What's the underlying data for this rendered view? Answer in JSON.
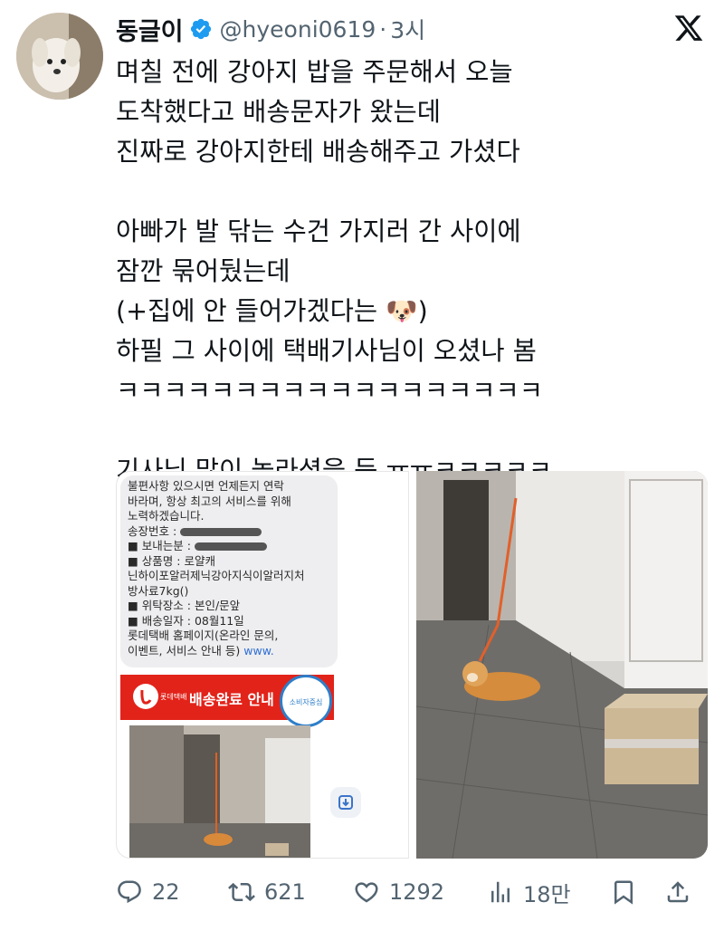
{
  "author": {
    "display_name": "동글이",
    "handle": "@hyeoni0619",
    "separator": "·",
    "time": "3시"
  },
  "tweet": {
    "lines": [
      "며칠 전에 강아지 밥을 주문해서 오늘",
      "도착했다고 배송문자가 왔는데",
      "진짜로 강아지한테 배송해주고 가셨다",
      "",
      "아빠가 발 닦는 수건 가지러 간 사이에",
      "잠깐 묶어뒀는데",
      "(+집에 안 들어가겠다는 🐶)",
      "하필 그 사이에 택배기사님이 오셨나 봄",
      "ㅋㅋㅋㅋㅋㅋㅋㅋㅋㅋㅋㅋㅋㅋㅋㅋㅋㅋ",
      "",
      "기사님 많이 놀라셨을 듯 ㅠㅠㅋㅋㅋㅋㅋ"
    ]
  },
  "media_left": {
    "message_lines": [
      "불편사항 있으시면 언제든지 연락",
      "바라며, 항상 최고의 서비스를 위해",
      "노력하겠습니다.",
      "송장번호 :",
      "■ 보내는분 :",
      "■ 상품명 : 로얄캐",
      "닌하이포알러제닉강아지식이알러지처",
      "방사료7kg()",
      "■ 위탁장소 : 본인/문앞",
      "■ 배송일자 : 08월11일",
      "롯데택배 홈페이지(온라인 문의,",
      "이벤트, 서비스 안내 등)"
    ],
    "message_link": "www.",
    "banner_brand": "롯데택배",
    "banner_title": "배송완료 안내",
    "badge_text": "소비자중심"
  },
  "actions": {
    "replies": "22",
    "retweets": "621",
    "likes": "1292",
    "views": "18만"
  },
  "colors": {
    "verified": "#1d9bf0",
    "text": "#0f1419",
    "muted": "#536471",
    "lotte_red": "#e2231a"
  }
}
